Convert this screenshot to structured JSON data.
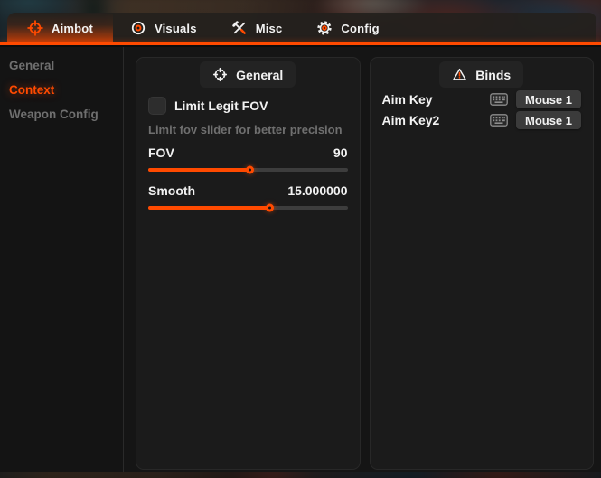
{
  "accent": "#ff4a00",
  "tabs": [
    {
      "label": "Aimbot",
      "icon": "crosshair-icon",
      "active": true
    },
    {
      "label": "Visuals",
      "icon": "eye-icon",
      "active": false
    },
    {
      "label": "Misc",
      "icon": "tools-icon",
      "active": false
    },
    {
      "label": "Config",
      "icon": "gear-icon",
      "active": false
    }
  ],
  "sidebar": {
    "items": [
      {
        "label": "General",
        "active": false
      },
      {
        "label": "Context",
        "active": true
      },
      {
        "label": "Weapon Config",
        "active": false
      }
    ]
  },
  "general_card": {
    "title": "General",
    "icon": "crosshair-icon",
    "checkbox": {
      "label": "Limit Legit FOV",
      "checked": false
    },
    "description": "Limit fov slider for better precision",
    "sliders": [
      {
        "label": "FOV",
        "value": "90",
        "percent": 50
      },
      {
        "label": "Smooth",
        "value": "15.000000",
        "percent": 60
      }
    ]
  },
  "binds_card": {
    "title": "Binds",
    "icon": "warning-triangle-icon",
    "rows": [
      {
        "label": "Aim Key",
        "icon": "keyboard-icon",
        "button": "Mouse 1"
      },
      {
        "label": "Aim Key2",
        "icon": "keyboard-icon",
        "button": "Mouse 1"
      }
    ]
  }
}
